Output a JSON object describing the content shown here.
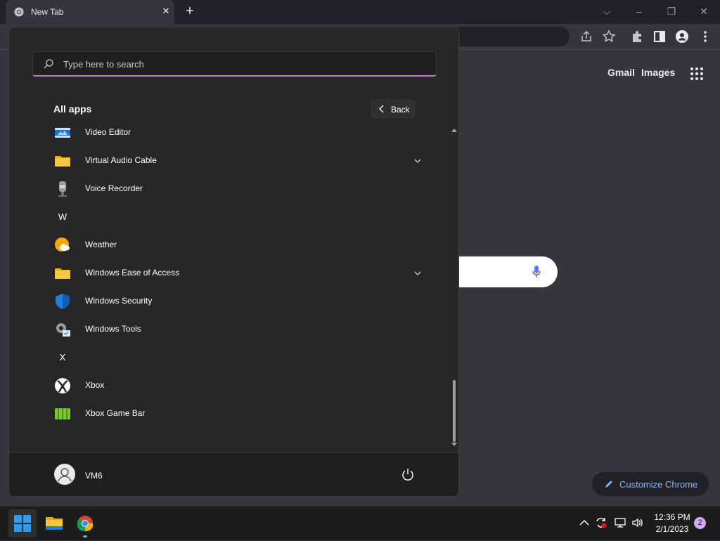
{
  "browser": {
    "tab_title": "New Tab",
    "links": {
      "gmail": "Gmail",
      "images": "Images"
    },
    "customize_label": "Customize Chrome"
  },
  "start_menu": {
    "search_placeholder": "Type here to search",
    "all_apps_title": "All apps",
    "back_label": "Back",
    "items": [
      {
        "kind": "app",
        "name": "Video Editor",
        "icon": "video-editor-icon"
      },
      {
        "kind": "app",
        "name": "Virtual Audio Cable",
        "icon": "folder-icon",
        "expandable": true
      },
      {
        "kind": "app",
        "name": "Voice Recorder",
        "icon": "microphone-icon"
      },
      {
        "kind": "letter",
        "name": "W"
      },
      {
        "kind": "app",
        "name": "Weather",
        "icon": "weather-icon"
      },
      {
        "kind": "app",
        "name": "Windows Ease of Access",
        "icon": "folder-icon",
        "expandable": true
      },
      {
        "kind": "app",
        "name": "Windows Security",
        "icon": "shield-icon"
      },
      {
        "kind": "app",
        "name": "Windows Tools",
        "icon": "tools-gear-icon"
      },
      {
        "kind": "letter",
        "name": "X"
      },
      {
        "kind": "app",
        "name": "Xbox",
        "icon": "xbox-icon"
      },
      {
        "kind": "app",
        "name": "Xbox Game Bar",
        "icon": "game-bar-icon"
      }
    ],
    "user_name": "VM6"
  },
  "taskbar": {
    "clock_time": "12:36 PM",
    "clock_date": "2/1/2023",
    "notification_count": "2",
    "pinned": [
      "start-button",
      "file-explorer-button",
      "chrome-button"
    ]
  },
  "colors": {
    "search_accent": "#c57bcd",
    "windows_blue": "#2b9ef4",
    "folder_yellow": "#f5c645",
    "xbox_green": "#7ac72f",
    "link_blue": "#8ab4f8"
  }
}
